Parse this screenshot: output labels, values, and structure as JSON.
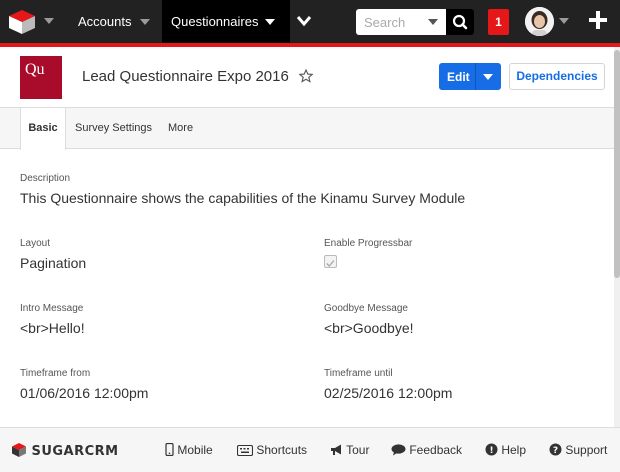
{
  "topnav": {
    "accounts": "Accounts",
    "questionnaires": "Questionnaires",
    "search_placeholder": "Search",
    "notifications": "1"
  },
  "record": {
    "module_abbr": "Qu",
    "title": "Lead Questionnaire Expo 2016",
    "edit": "Edit",
    "dependencies": "Dependencies"
  },
  "tabs": [
    {
      "label": "Basic",
      "active": true
    },
    {
      "label": "Survey Settings",
      "active": false
    },
    {
      "label": "More",
      "active": false
    }
  ],
  "fields": {
    "description": {
      "label": "Description",
      "value": "This Questionnaire shows the capabilities of the Kinamu Survey Module"
    },
    "layout": {
      "label": "Layout",
      "value": "Pagination"
    },
    "progressbar": {
      "label": "Enable Progressbar",
      "checked": true
    },
    "intro": {
      "label": "Intro Message",
      "value": "<br>Hello!"
    },
    "goodbye": {
      "label": "Goodbye Message",
      "value": "<br>Goodbye!"
    },
    "timeframe_from": {
      "label": "Timeframe from",
      "value": "01/06/2016 12:00pm"
    },
    "timeframe_until": {
      "label": "Timeframe until",
      "value": "02/25/2016 12:00pm"
    }
  },
  "footer": {
    "logo_text": "SUGARCRM",
    "mobile": "Mobile",
    "shortcuts": "Shortcuts",
    "tour": "Tour",
    "feedback": "Feedback",
    "help": "Help",
    "support": "Support"
  },
  "colors": {
    "accent_red": "#e61718",
    "module_badge": "#a80c2a",
    "primary_blue": "#176de5"
  }
}
